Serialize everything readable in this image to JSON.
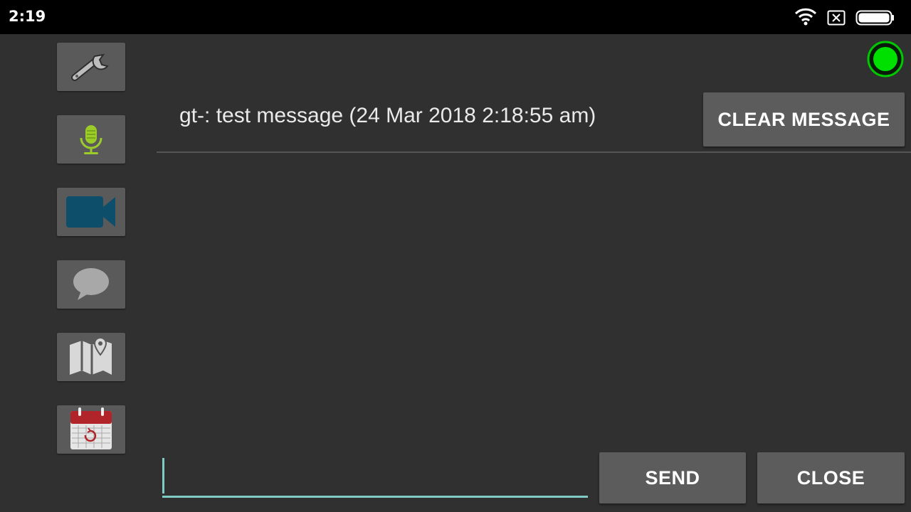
{
  "status_bar": {
    "time": "2:19",
    "icons": [
      "wifi-icon",
      "no-sim-icon",
      "battery-icon"
    ]
  },
  "sidebar": {
    "items": [
      {
        "name": "settings",
        "icon": "wrench-icon"
      },
      {
        "name": "audio",
        "icon": "microphone-icon"
      },
      {
        "name": "video",
        "icon": "video-camera-icon"
      },
      {
        "name": "chat",
        "icon": "chat-bubble-icon"
      },
      {
        "name": "map",
        "icon": "map-icon"
      },
      {
        "name": "calendar",
        "icon": "calendar-icon"
      }
    ]
  },
  "connection": {
    "status": "connected",
    "color": "#00e000"
  },
  "message": {
    "text": "gt-: test message (24 Mar 2018 2:18:55 am)"
  },
  "buttons": {
    "clear_label": "CLEAR MESSAGE",
    "send_label": "SEND",
    "close_label": "CLOSE"
  },
  "composer": {
    "value": "",
    "placeholder": ""
  },
  "colors": {
    "background": "#303030",
    "button": "#5c5c5c",
    "accent": "#80cbc4"
  }
}
